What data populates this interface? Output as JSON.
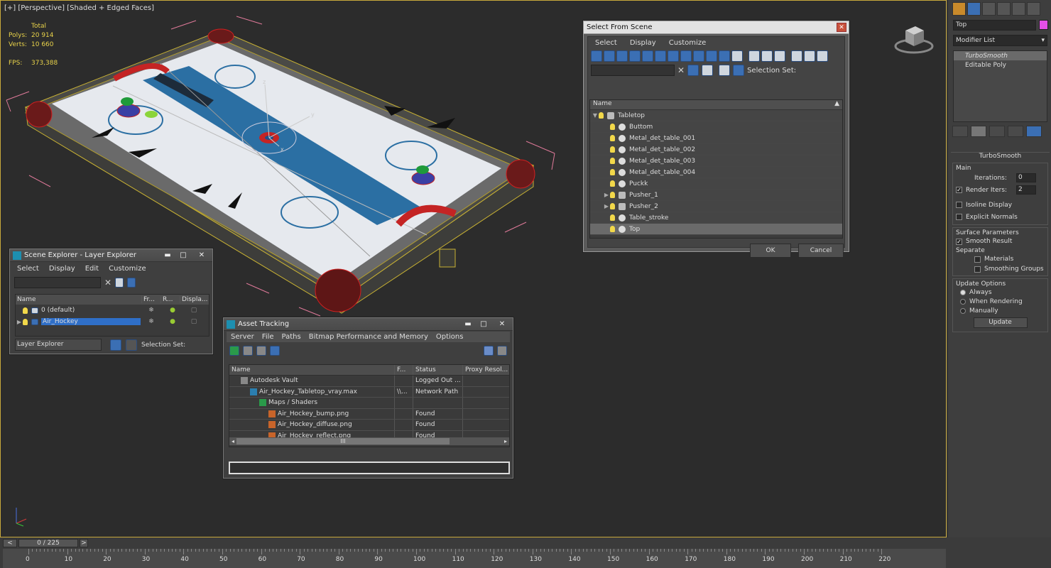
{
  "viewport": {
    "label": "[+] [Perspective] [Shaded + Edged Faces]",
    "stats": {
      "header": "Total",
      "polys_label": "Polys:",
      "polys": "20 914",
      "verts_label": "Verts:",
      "verts": "10 660",
      "fps_label": "FPS:",
      "fps": "373,388"
    },
    "gizmo": {
      "x": "x",
      "y": "y",
      "z": "z"
    }
  },
  "select_from_scene": {
    "title": "Select From Scene",
    "menu": [
      "Select",
      "Display",
      "Customize"
    ],
    "selection_set_label": "Selection Set:",
    "column_name": "Name",
    "rows": [
      {
        "name": "Tabletop",
        "level": 0,
        "expand": "▼",
        "group": true
      },
      {
        "name": "Buttom",
        "level": 1,
        "expand": ""
      },
      {
        "name": "Metal_det_table_001",
        "level": 1,
        "expand": ""
      },
      {
        "name": "Metal_det_table_002",
        "level": 1,
        "expand": ""
      },
      {
        "name": "Metal_det_table_003",
        "level": 1,
        "expand": ""
      },
      {
        "name": "Metal_det_table_004",
        "level": 1,
        "expand": ""
      },
      {
        "name": "Puckk",
        "level": 1,
        "expand": ""
      },
      {
        "name": "Pusher_1",
        "level": 1,
        "expand": "▶",
        "group": true
      },
      {
        "name": "Pusher_2",
        "level": 1,
        "expand": "▶",
        "group": true
      },
      {
        "name": "Table_stroke",
        "level": 1,
        "expand": ""
      },
      {
        "name": "Top",
        "level": 1,
        "expand": "",
        "selected": true
      }
    ],
    "ok": "OK",
    "cancel": "Cancel"
  },
  "scene_explorer": {
    "title": "Scene Explorer - Layer Explorer",
    "menu": [
      "Select",
      "Display",
      "Edit",
      "Customize"
    ],
    "columns": [
      "Name",
      "Fr...",
      "R...",
      "Displa..."
    ],
    "rows": [
      {
        "name": "0 (default)",
        "selected": false
      },
      {
        "name": "Air_Hockey",
        "selected": true
      }
    ],
    "explorer_dropdown": "Layer Explorer",
    "selection_set_label": "Selection Set:"
  },
  "asset_tracking": {
    "title": "Asset Tracking",
    "menu": [
      "Server",
      "File",
      "Paths",
      "Bitmap Performance and Memory",
      "Options"
    ],
    "columns": [
      "Name",
      "F...",
      "Status",
      "Proxy Resol..."
    ],
    "rows": [
      {
        "name": "Autodesk Vault",
        "full": "",
        "status": "Logged Out ...",
        "indent": 1
      },
      {
        "name": "Air_Hockey_Tabletop_vray.max",
        "full": "\\\\...",
        "status": "Network Path",
        "indent": 2
      },
      {
        "name": "Maps / Shaders",
        "full": "",
        "status": "",
        "indent": 3
      },
      {
        "name": "Air_Hockey_bump.png",
        "full": "",
        "status": "Found",
        "indent": 4
      },
      {
        "name": "Air_Hockey_diffuse.png",
        "full": "",
        "status": "Found",
        "indent": 4
      },
      {
        "name": "Air_Hockey_reflect.png",
        "full": "",
        "status": "Found",
        "indent": 4
      }
    ],
    "scroll_label": "III"
  },
  "command_panel": {
    "object_name": "Top",
    "object_color": "#e44fe6",
    "modifier_list": "Modifier List",
    "stack": [
      "TurboSmooth",
      "Editable Poly"
    ],
    "rollout_title": "TurboSmooth",
    "main": {
      "label": "Main",
      "iterations_label": "Iterations:",
      "iterations": "0",
      "render_iters_label": "Render Iters:",
      "render_iters": "2",
      "isoline": "Isoline Display",
      "explicit_normals": "Explicit Normals"
    },
    "surface": {
      "label": "Surface Parameters",
      "smooth_result": "Smooth Result",
      "separate": "Separate",
      "materials": "Materials",
      "smoothing_groups": "Smoothing Groups"
    },
    "update_options": {
      "label": "Update Options",
      "always": "Always",
      "when_rendering": "When Rendering",
      "manually": "Manually",
      "update_button": "Update"
    }
  },
  "timeline": {
    "frame_readout": "0 / 225",
    "ticks": [
      "0",
      "10",
      "20",
      "30",
      "40",
      "50",
      "60",
      "70",
      "80",
      "90",
      "100",
      "110",
      "120",
      "130",
      "140",
      "150",
      "160",
      "170",
      "180",
      "190",
      "200",
      "210",
      "220"
    ]
  }
}
